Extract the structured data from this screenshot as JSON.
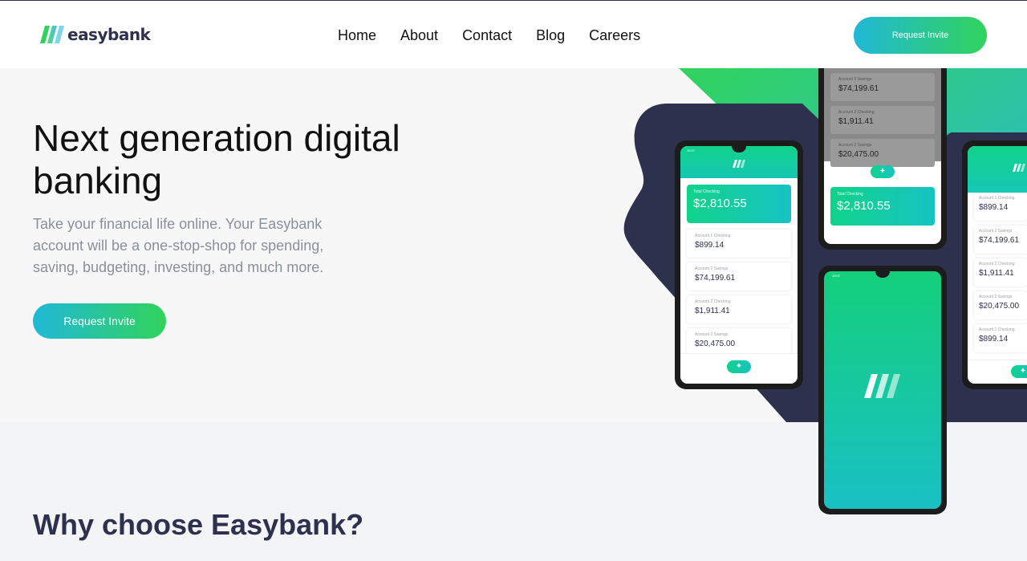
{
  "brand": {
    "name": "easybank"
  },
  "nav": {
    "items": [
      "Home",
      "About",
      "Contact",
      "Blog",
      "Careers"
    ]
  },
  "header": {
    "cta_label": "Request Invite"
  },
  "hero": {
    "title": "Next generation digital banking",
    "text": "Take your financial life online. Your Easybank account will be a one-stop-shop for spending, saving, budgeting, investing, and much more.",
    "cta_label": "Request Invite"
  },
  "phones": {
    "left": {
      "time": "10:07",
      "total_label": "Total Checking",
      "total_amount": "$2,810.55",
      "accounts": [
        {
          "label": "Account 1 Checking",
          "amount": "$899.14"
        },
        {
          "label": "Account 2 Savings",
          "amount": "$74,199.61"
        },
        {
          "label": "Account 2 Checking",
          "amount": "$1,911.41"
        },
        {
          "label": "Account 2 Savings",
          "amount": "$20,475.00"
        }
      ]
    },
    "top": {
      "accounts": [
        {
          "label": "Account 2 Savings",
          "amount": "$74,199.61"
        },
        {
          "label": "Account 2 Checking",
          "amount": "$1,911.41"
        },
        {
          "label": "Account 2 Savings",
          "amount": "$20,475.00"
        }
      ],
      "total_label": "Total Checking",
      "total_amount": "$2,810.55"
    },
    "center": {
      "time": "10:07"
    },
    "right": {
      "accounts": [
        {
          "label": "Account 1 Checking",
          "amount": "$899.14"
        },
        {
          "label": "Account 2 Savings",
          "amount": "$74,199.61"
        },
        {
          "label": "Account 2 Checking",
          "amount": "$1,911.41"
        },
        {
          "label": "Account 2 Savings",
          "amount": "$20,475.00"
        },
        {
          "label": "Account 1 Checking",
          "amount": "$899.14"
        }
      ]
    }
  },
  "why": {
    "title": "Why choose Easybank?"
  },
  "colors": {
    "dark_blue": "#2d314d",
    "lime_green": "#31d35c",
    "bright_cyan": "#2bb7da",
    "grayish_blue": "#9698a6",
    "light_gray": "#f3f4f6"
  }
}
